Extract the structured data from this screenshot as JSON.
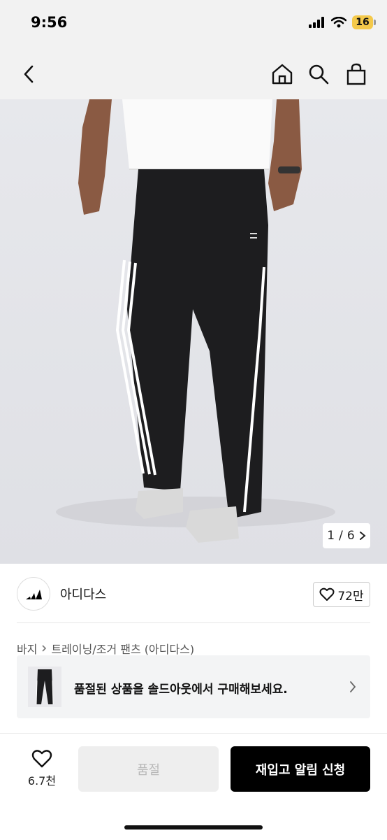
{
  "status": {
    "time": "9:56",
    "battery": "16"
  },
  "brand": {
    "name": "아디다스",
    "likes": "72만"
  },
  "image": {
    "counter_current": "1",
    "counter_sep": "/",
    "counter_total": "6"
  },
  "breadcrumb": {
    "category": "바지",
    "subcategory": "트레이닝/조거 팬츠 (아디다스)"
  },
  "banner": {
    "text": "품절된 상품을 솔드아웃에서 구매해보세요."
  },
  "bottom": {
    "wish_count": "6.7천",
    "soldout_label": "품절",
    "restock_label": "재입고 알림 신청"
  },
  "colors": {
    "accent": "#000000",
    "banner_bg": "#f3f4f5",
    "battery": "#f4c94a"
  },
  "icons": [
    "back-icon",
    "home-icon",
    "search-icon",
    "bag-icon",
    "heart-icon",
    "chevron-right-icon",
    "adidas-logo"
  ]
}
